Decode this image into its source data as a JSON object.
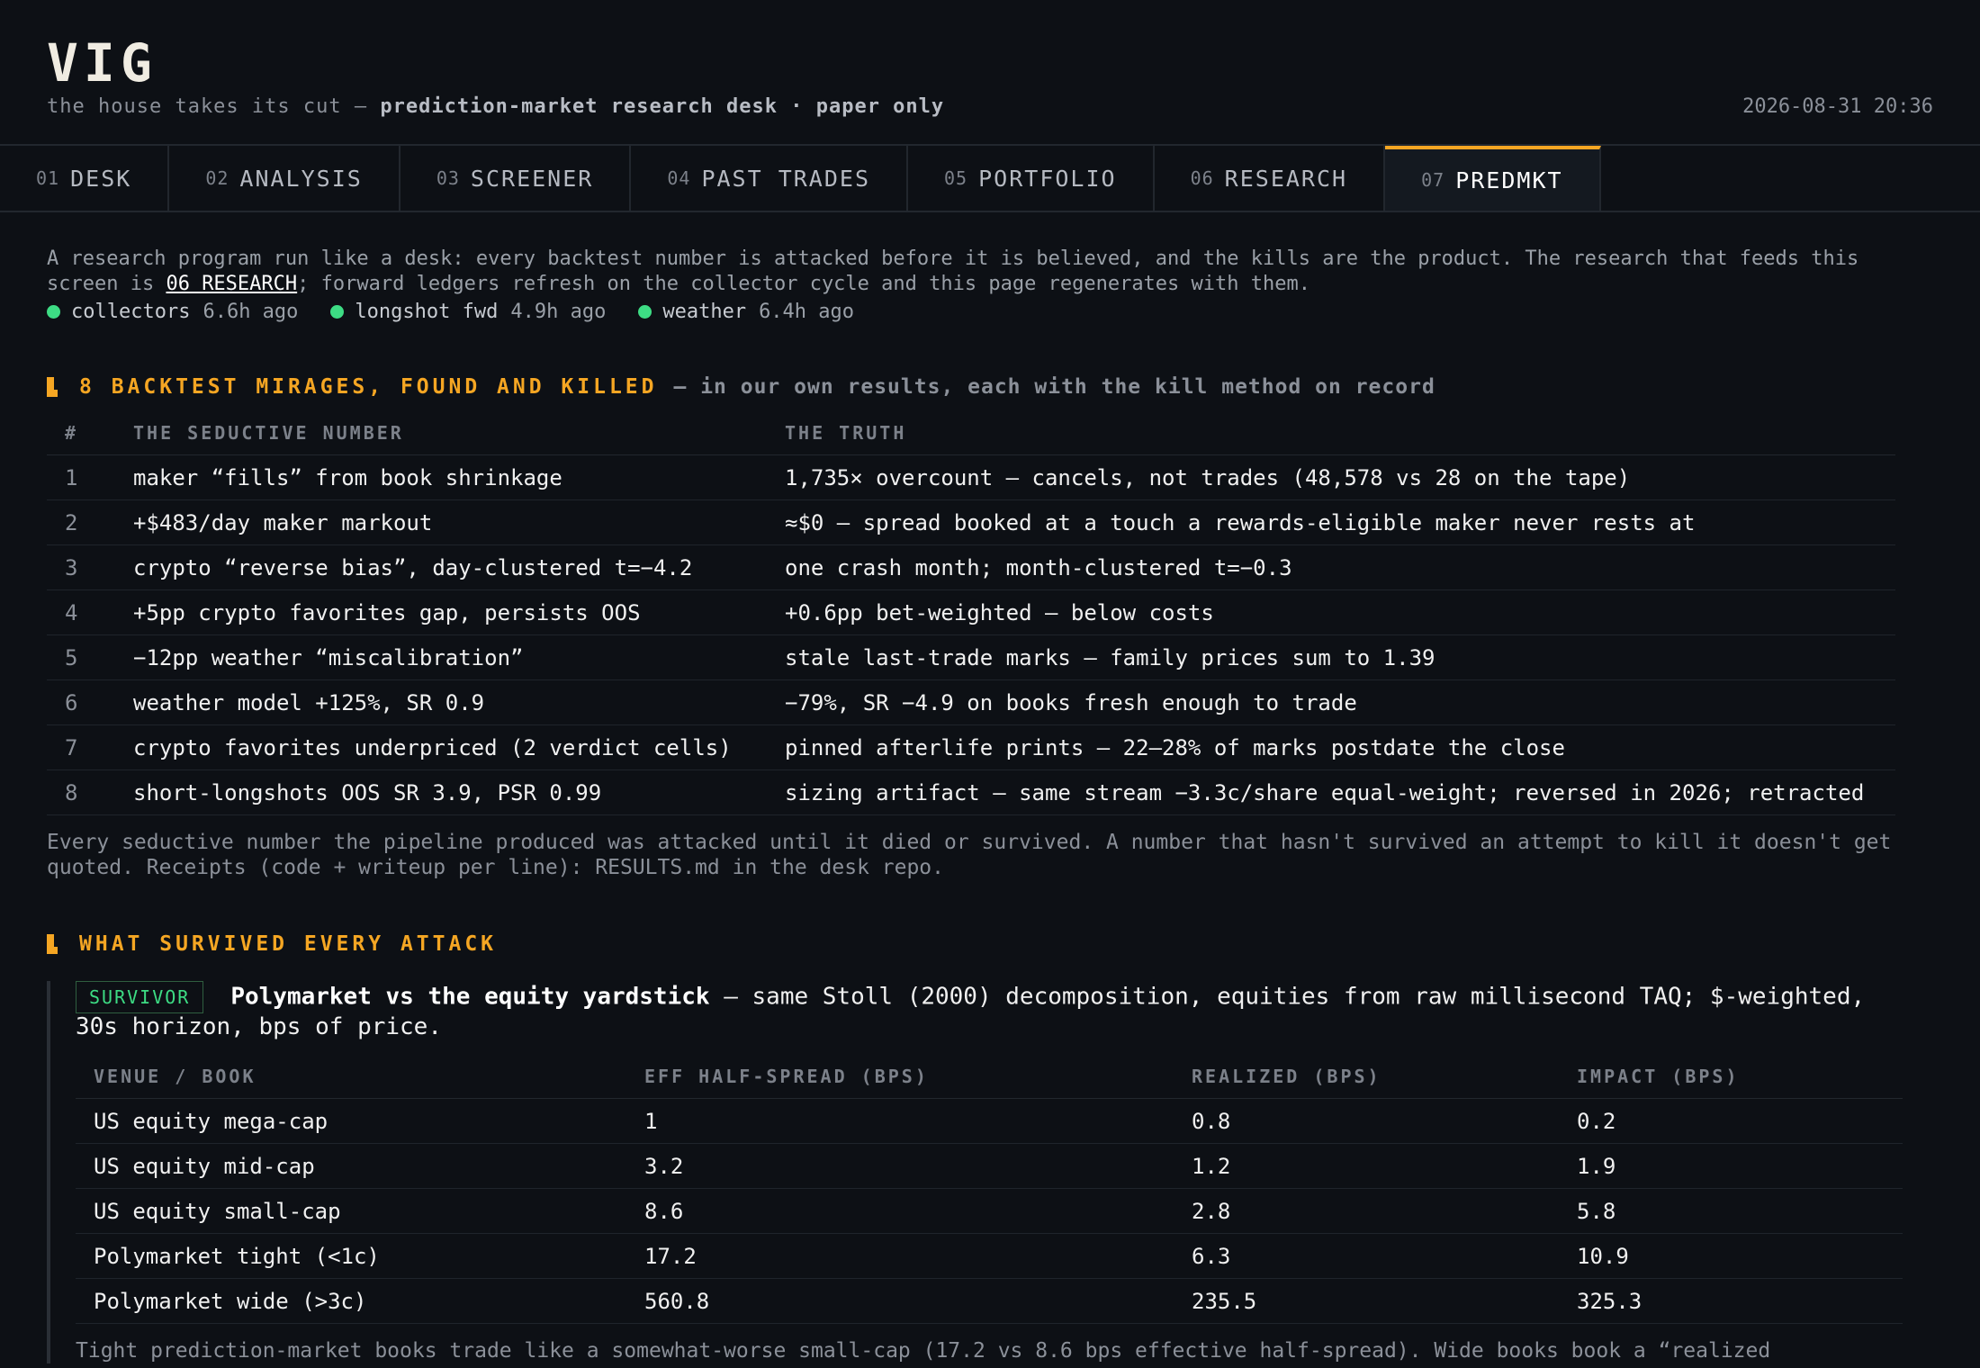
{
  "header": {
    "brand": "VIG",
    "tagline_plain": "the house takes its cut — ",
    "tagline_bold": "prediction-market research desk · paper only",
    "timestamp": "2026-08-31 20:36"
  },
  "tabs": [
    {
      "num": "01",
      "label": "DESK"
    },
    {
      "num": "02",
      "label": "ANALYSIS"
    },
    {
      "num": "03",
      "label": "SCREENER"
    },
    {
      "num": "04",
      "label": "PAST TRADES"
    },
    {
      "num": "05",
      "label": "PORTFOLIO"
    },
    {
      "num": "06",
      "label": "RESEARCH"
    },
    {
      "num": "07",
      "label": "PREDMKT",
      "active": true
    }
  ],
  "intro": {
    "text_before": "A research program run like a desk: every backtest number is attacked before it is believed, and the kills are the product. The research that feeds this screen is ",
    "link": "06 RESEARCH",
    "text_after": "; forward ledgers refresh on the collector cycle and this page regenerates with them."
  },
  "status": [
    {
      "name": "collectors",
      "age": "6.6h ago",
      "color": "#3ddc84"
    },
    {
      "name": "longshot fwd",
      "age": "4.9h ago",
      "color": "#3ddc84"
    },
    {
      "name": "weather",
      "age": "6.4h ago",
      "color": "#3ddc84"
    }
  ],
  "mirages": {
    "title": "8 BACKTEST MIRAGES, FOUND AND KILLED",
    "subtitle": "— in our own results, each with the kill method on record",
    "columns": [
      "#",
      "THE SEDUCTIVE NUMBER",
      "THE TRUTH"
    ],
    "rows": [
      {
        "n": "1",
        "seductive": "maker “fills” from book shrinkage",
        "truth": "1,735× overcount — cancels, not trades (48,578 vs 28 on the tape)"
      },
      {
        "n": "2",
        "seductive": "+$483/day maker markout",
        "truth": "≈$0 — spread booked at a touch a rewards-eligible maker never rests at"
      },
      {
        "n": "3",
        "seductive": "crypto “reverse bias”, day-clustered t=−4.2",
        "truth": "one crash month; month-clustered t=−0.3"
      },
      {
        "n": "4",
        "seductive": "+5pp crypto favorites gap, persists OOS",
        "truth": "+0.6pp bet-weighted — below costs"
      },
      {
        "n": "5",
        "seductive": "−12pp weather “miscalibration”",
        "truth": "stale last-trade marks — family prices sum to 1.39"
      },
      {
        "n": "6",
        "seductive": "weather model +125%, SR 0.9",
        "truth": "−79%, SR −4.9 on books fresh enough to trade"
      },
      {
        "n": "7",
        "seductive": "crypto favorites underpriced (2 verdict cells)",
        "truth": "pinned afterlife prints — 22–28% of marks postdate the close"
      },
      {
        "n": "8",
        "seductive": "short-longshots OOS SR 3.9, PSR 0.99",
        "truth": "sizing artifact — same stream −3.3c/share equal-weight; reversed in 2026; retracted"
      }
    ],
    "note": "Every seductive number the pipeline produced was attacked until it died or survived. A number that hasn't survived an attempt to kill it doesn't get quoted. Receipts (code + writeup per line): RESULTS.md in the desk repo."
  },
  "survived": {
    "title": "WHAT SURVIVED EVERY ATTACK",
    "badge": "SURVIVOR",
    "headline_bold": "Polymarket vs the equity yardstick",
    "headline_rest": " — same Stoll (2000) decomposition, equities from raw millisecond TAQ; $-weighted, 30s horizon, bps of price.",
    "columns": [
      "VENUE / BOOK",
      "EFF HALF-SPREAD (BPS)",
      "REALIZED (BPS)",
      "IMPACT (BPS)"
    ],
    "rows": [
      {
        "venue": "US equity mega-cap",
        "eff": "1",
        "realized": "0.8",
        "impact": "0.2"
      },
      {
        "venue": "US equity mid-cap",
        "eff": "3.2",
        "realized": "1.2",
        "impact": "1.9"
      },
      {
        "venue": "US equity small-cap",
        "eff": "8.6",
        "realized": "2.8",
        "impact": "5.8"
      },
      {
        "venue": "Polymarket tight (<1c)",
        "eff": "17.2",
        "realized": "6.3",
        "impact": "10.9"
      },
      {
        "venue": "Polymarket wide (>3c)",
        "eff": "560.8",
        "realized": "235.5",
        "impact": "325.3"
      }
    ],
    "note": "Tight prediction-market books trade like a somewhat-worse small-cap (17.2 vs 8.6 bps effective half-spread). Wide books book a “realized"
  }
}
